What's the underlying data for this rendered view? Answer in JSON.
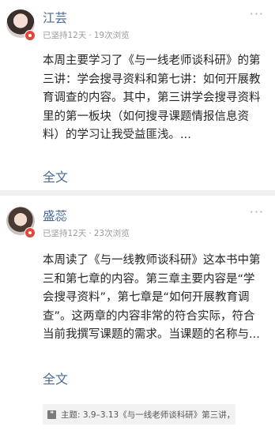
{
  "posts": [
    {
      "author": "江芸",
      "persisted": "已坚持12天",
      "views": "19次浏览",
      "body": "本周主要学习了《与一线老师谈科研》的第三讲：学会搜寻资料和第七讲：如何开展教育调查的内容。其中，第三讲学会搜寻资料里的第一板块（如何搜寻课题情报信息资料）的学习让我受益匪浅。...",
      "fulltext_label": "全文"
    },
    {
      "author": "盛蕊",
      "persisted": "已坚持12天",
      "views": "23次浏览",
      "body": "本周读了《与一线教师谈科研》这本书中第三和第七章的内容。第三章主要内容是“学会搜寻资料”，第七章是“如何开展教育调查”。这两章的内容非常的符合实际，符合当前我撰写课题的需求。当课题的名称与...",
      "fulltext_label": "全文",
      "topic": "主题: 3.9–3.13《与一线老师谈科研》第三讲，..."
    }
  ],
  "more_icon": "···",
  "separator": "·",
  "quote_icon_glyph": "❝"
}
